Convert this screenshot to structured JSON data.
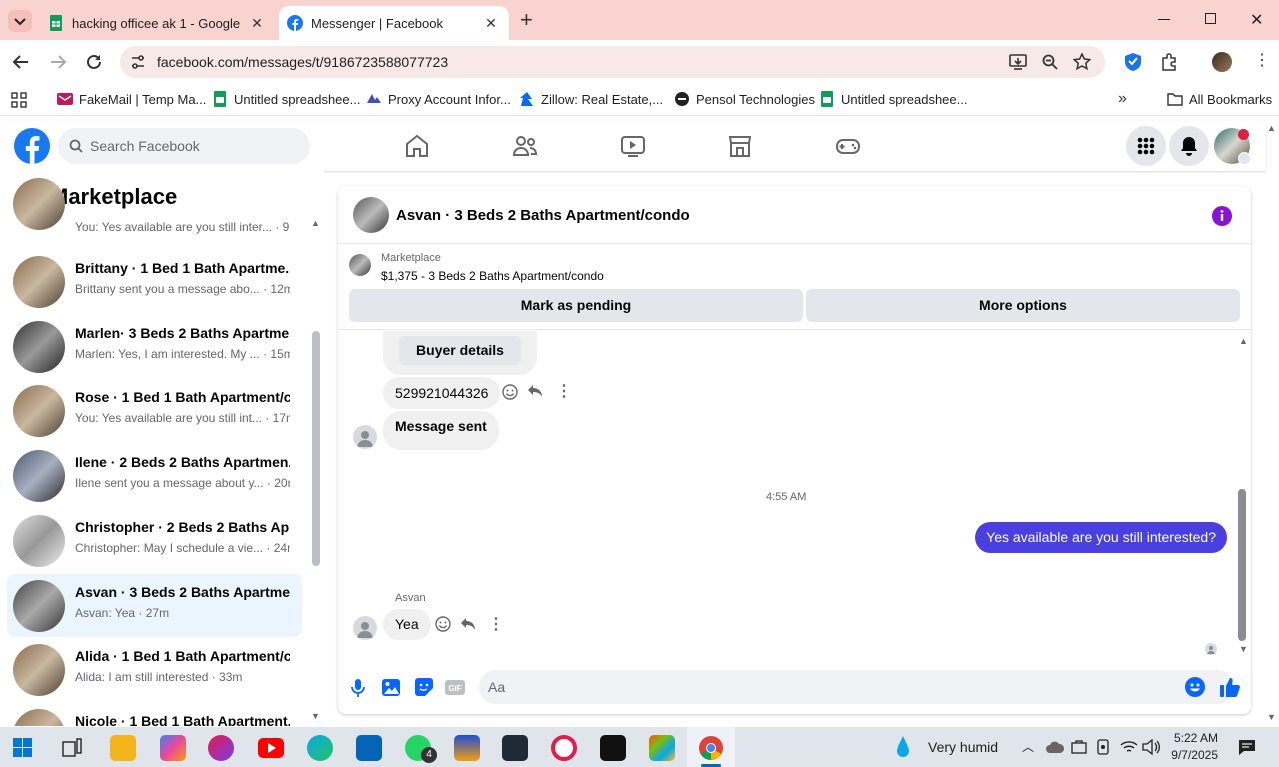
{
  "browser": {
    "tabs": [
      {
        "title": "hacking officee ak 1 - Google S"
      },
      {
        "title": "Messenger | Facebook"
      }
    ],
    "url": "facebook.com/messages/t/9186723588077723",
    "bookmarks": [
      {
        "label": "FakeMail | Temp Ma..."
      },
      {
        "label": "Untitled spreadshee..."
      },
      {
        "label": "Proxy Account Infor..."
      },
      {
        "label": "Zillow: Real Estate,..."
      },
      {
        "label": "Pensol Technologies"
      },
      {
        "label": "Untitled spreadshee..."
      }
    ],
    "all_bookmarks": "All Bookmarks"
  },
  "fb": {
    "search_placeholder": "Search Facebook"
  },
  "sidebar": {
    "title": "Marketplace",
    "conversations": [
      {
        "name": "",
        "preview": "You: Yes available are you still inter... · 9m"
      },
      {
        "name": "Brittany · 1 Bed 1 Bath Apartme...",
        "preview": "Brittany sent you a message abo... · 12m"
      },
      {
        "name": "Marlen· 3 Beds 2 Baths Apartme...",
        "preview": "Marlen: Yes, I am interested. My ... · 15m"
      },
      {
        "name": "Rose · 1 Bed 1 Bath Apartment/c...",
        "preview": "You: Yes available are you still int... · 17m"
      },
      {
        "name": "Ilene · 2 Beds 2 Baths Apartmen...",
        "preview": "Ilene sent you a message about y... · 20m"
      },
      {
        "name": "Christopher · 2 Beds 2 Baths Ap...",
        "preview": "Christopher: May I schedule a vie... · 24m"
      },
      {
        "name": "Asvan · 3 Beds 2 Baths Apartme...",
        "preview": "Asvan: Yea · 27m"
      },
      {
        "name": "Alida · 1 Bed 1 Bath Apartment/c...",
        "preview": "Alida: I am still interested · 33m"
      },
      {
        "name": "Nicole · 1 Bed 1 Bath Apartment...",
        "preview": ""
      }
    ]
  },
  "chat": {
    "title": "Asvan · 3 Beds 2 Baths Apartment/condo",
    "listing_source": "Marketplace",
    "listing_title": "$1,375 - 3 Beds 2 Baths Apartment/condo",
    "mark_pending": "Mark as pending",
    "more_options": "More options",
    "messages": {
      "buyer_details": "Buyer details",
      "code": "529921044326",
      "sent": "Message sent",
      "timestamp": "4:55 AM",
      "outgoing": "Yes available are you still  interested?",
      "sender": "Asvan",
      "reply": "Yea"
    },
    "input_placeholder": "Aa"
  },
  "taskbar": {
    "weather": "Very humid",
    "time": "5:22 AM",
    "date": "9/7/2025",
    "whatsapp_badge": "4"
  },
  "colors": {
    "fb_blue": "#1877f2",
    "bubble_purple": "#4a3fe0",
    "tab_bar": "#f9d3cf"
  }
}
